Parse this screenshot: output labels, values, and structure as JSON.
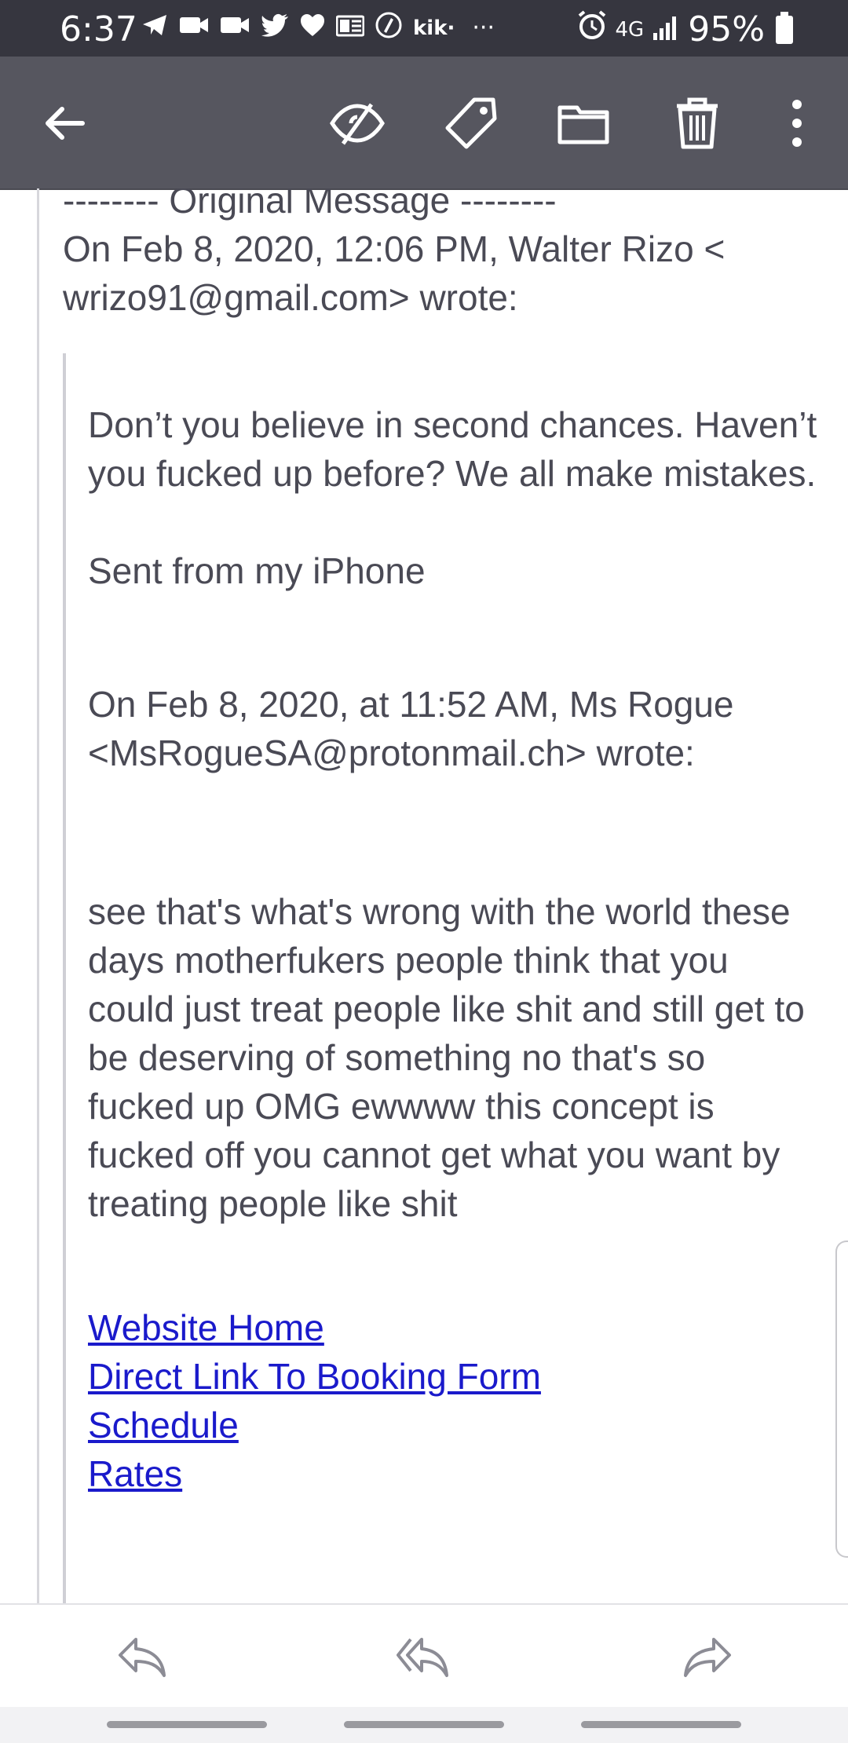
{
  "status_bar": {
    "time": "6:37",
    "notification_icons": [
      "telegram-icon",
      "video-icon",
      "video-icon",
      "twitter-icon",
      "heart-icon",
      "outlook-icon",
      "sketch-icon",
      "kik-icon",
      "more-dots-icon"
    ],
    "kik_label": "kik·",
    "dots_label": "···",
    "network_label": "4G",
    "battery_percent": "95%"
  },
  "toolbar": {
    "actions": [
      "back-arrow-icon",
      "hide-eye-icon",
      "tag-icon",
      "folder-icon",
      "trash-icon",
      "more-vertical-icon"
    ]
  },
  "email": {
    "original_header": "-------- Original Message --------",
    "sent_line": "On Feb 8, 2020, 12:06 PM, Walter Rizo < wrizo91@gmail.com> wrote:",
    "reply_paragraph": "Don’t you believe in second chances. Haven’t you fucked up before? We all make mistakes.",
    "signature": "Sent from my iPhone",
    "quoted_header": "On Feb 8, 2020, at 11:52 AM, Ms Rogue <MsRogueSA@protonmail.ch> wrote:",
    "quoted_body": "see that's what's wrong with the world these days motherfukers people think that you could just treat people like shit and still get to be deserving of something no that's so fucked up OMG ewwww this concept is fucked off you cannot get what you want by treating people like shit",
    "links": [
      "Website Home",
      "Direct Link To Booking Form",
      "Schedule",
      "Rates"
    ]
  },
  "bottom_actions": [
    "reply-icon",
    "reply-all-icon",
    "forward-icon"
  ],
  "colors": {
    "toolbar_bg": "#56565f",
    "status_bg": "#36363f",
    "link": "#1a1acb",
    "text": "#4a4a55"
  }
}
